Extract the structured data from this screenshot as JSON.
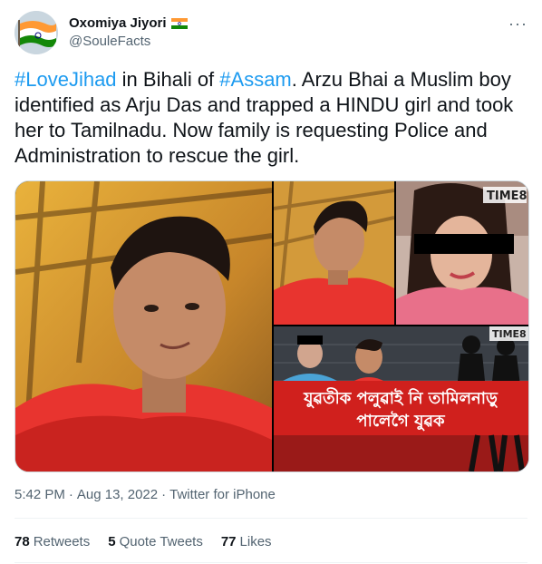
{
  "author": {
    "display_name": "Oxomiya Jiyori",
    "flag_icon": "india-flag-icon",
    "handle": "@SouleFacts"
  },
  "tweet": {
    "segments": [
      {
        "text": "#LoveJihad",
        "hashtag": true
      },
      {
        "text": " in Bihali of ",
        "hashtag": false
      },
      {
        "text": "#Assam",
        "hashtag": true
      },
      {
        "text": ". Arzu Bhai a Muslim boy identified as Arju Das and trapped a HINDU girl and took her to Tamilnadu. Now family is requesting Police and Administration to rescue the girl.",
        "hashtag": false
      }
    ]
  },
  "media": {
    "watermark_1": "TIME8",
    "watermark_2": "TIME8",
    "overlay_line_1": "যুৱতীক পলুৱাই নি তামিলনাড়ু",
    "overlay_line_2": "পালেগৈ যুৱক"
  },
  "meta": {
    "time": "5:42 PM",
    "separator_1": "·",
    "date": "Aug 13, 2022",
    "separator_2": "·",
    "source": "Twitter for iPhone"
  },
  "stats": {
    "retweets_count": "78",
    "retweets_label": "Retweets",
    "quotes_count": "5",
    "quotes_label": "Quote Tweets",
    "likes_count": "77",
    "likes_label": "Likes"
  },
  "colors": {
    "hashtag": "#1d9bf0",
    "secondary_text": "#536471",
    "primary_text": "#0f1419"
  }
}
